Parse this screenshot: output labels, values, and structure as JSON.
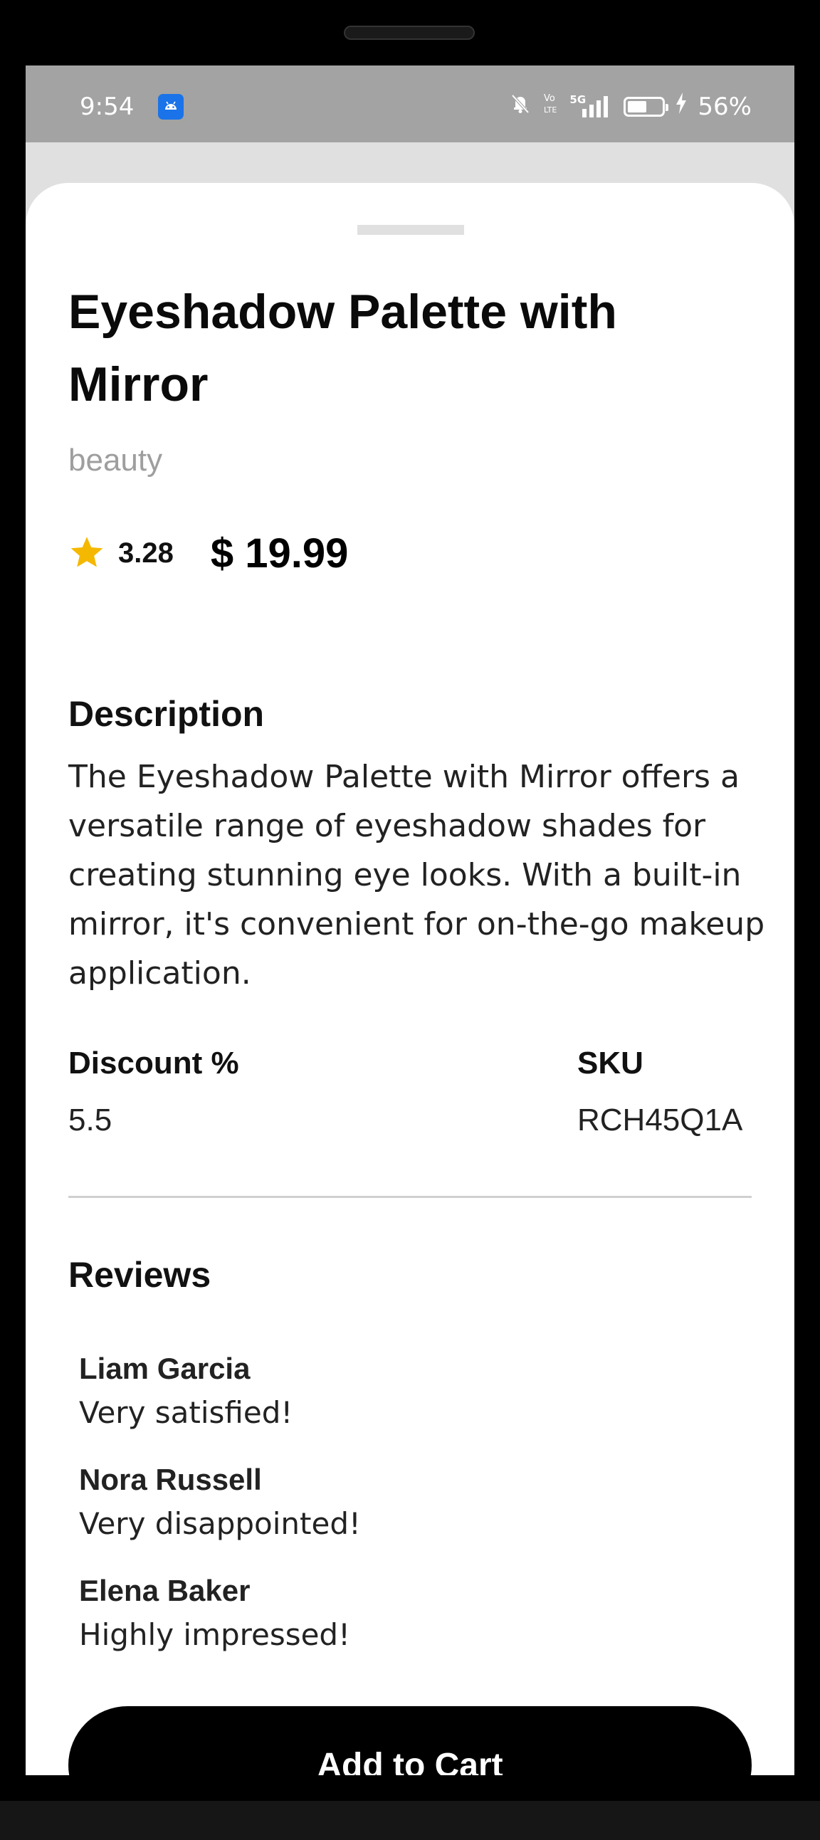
{
  "status_bar": {
    "time": "9:54",
    "network_label": "5G",
    "battery_percent": "56%",
    "battery_level": 0.56,
    "icons": [
      "android-app-icon",
      "bell-off-icon",
      "volte-icon",
      "signal-icon",
      "battery-icon",
      "charging-bolt-icon"
    ]
  },
  "product": {
    "title": "Eyeshadow Palette with Mirror",
    "category": "beauty",
    "rating": "3.28",
    "price": "$ 19.99",
    "description_heading": "Description",
    "description": "The Eyeshadow Palette with Mirror offers a versatile range of eyeshadow shades for creating stunning eye looks. With a built-in mirror, it's convenient for on-the-go makeup application.",
    "discount_label": "Discount %",
    "discount_value": "5.5",
    "sku_label": "SKU",
    "sku_value": "RCH45Q1A"
  },
  "reviews": {
    "heading": "Reviews",
    "items": [
      {
        "name": "Liam Garcia",
        "comment": "Very satisfied!"
      },
      {
        "name": "Nora Russell",
        "comment": "Very disappointed!"
      },
      {
        "name": "Elena Baker",
        "comment": "Highly impressed!"
      }
    ]
  },
  "actions": {
    "add_to_cart_label": "Add to Cart"
  },
  "colors": {
    "star": "#F5B800",
    "button_bg": "#000000",
    "category_text": "#9E9E9E",
    "status_bar_bg": "#A3A3A3"
  }
}
